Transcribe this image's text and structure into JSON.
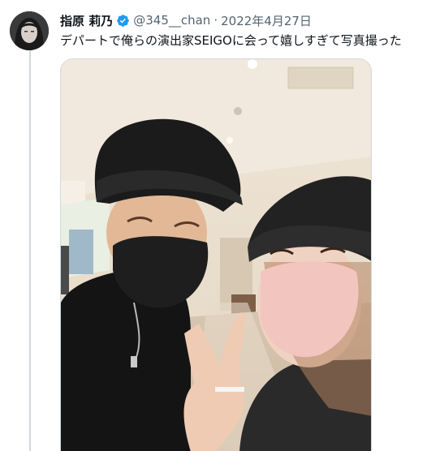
{
  "tweet": {
    "display_name": "指原 莉乃",
    "handle": "@345__chan",
    "separator": "·",
    "date": "2022年4月27日",
    "text": "デパートで俺らの演出家SEIGOに会って嬉しすぎて写真撮った",
    "verified": true
  },
  "colors": {
    "verified_blue": "#1d9bf0",
    "secondary_text": "#536471",
    "primary_text": "#0f1419",
    "divider": "#cfd9de"
  },
  "icons": {
    "verified": "verified-badge-icon"
  }
}
